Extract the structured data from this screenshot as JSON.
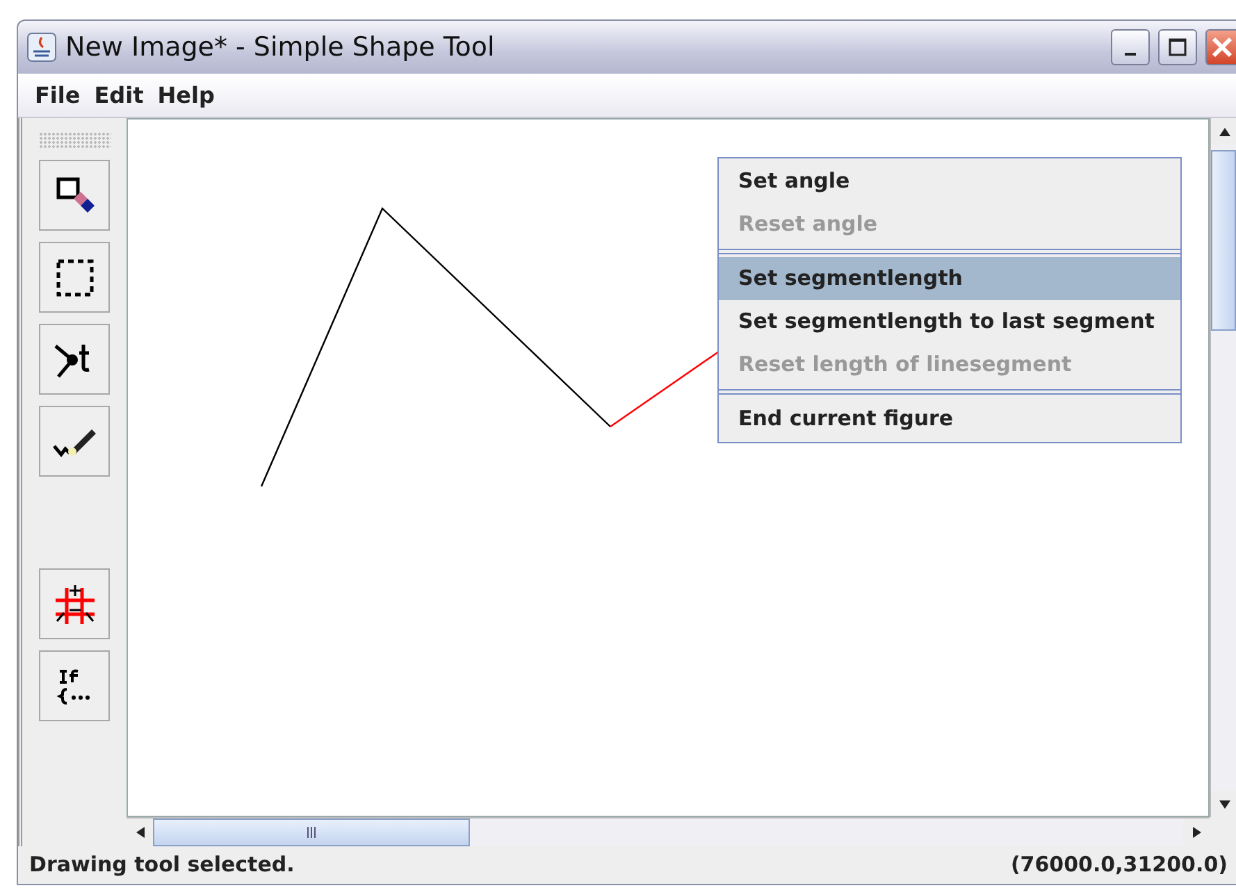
{
  "window": {
    "title": "New Image* - Simple Shape Tool"
  },
  "menu_bar": [
    "File",
    "Edit",
    "Help"
  ],
  "context_menu": [
    {
      "kind": "item",
      "label": "Set angle",
      "disabled": false,
      "selected": false
    },
    {
      "kind": "item",
      "label": "Reset angle",
      "disabled": true,
      "selected": false
    },
    {
      "kind": "separator"
    },
    {
      "kind": "item",
      "label": "Set segmentlength",
      "disabled": false,
      "selected": true
    },
    {
      "kind": "item",
      "label": "Set segmentlength to last segment",
      "disabled": false,
      "selected": false
    },
    {
      "kind": "item",
      "label": "Reset length of linesegment",
      "disabled": true,
      "selected": false
    },
    {
      "kind": "separator"
    },
    {
      "kind": "item",
      "label": "End current figure",
      "disabled": false,
      "selected": false
    }
  ],
  "tools": [
    {
      "kind": "eraser"
    },
    {
      "kind": "select"
    },
    {
      "kind": "node"
    },
    {
      "kind": "pen"
    },
    {
      "kind": "gap"
    },
    {
      "kind": "grid"
    },
    {
      "kind": "script"
    }
  ],
  "status_bar": {
    "message": "Drawing tool selected.",
    "coordinates": "(76000.0,31200.0)"
  }
}
